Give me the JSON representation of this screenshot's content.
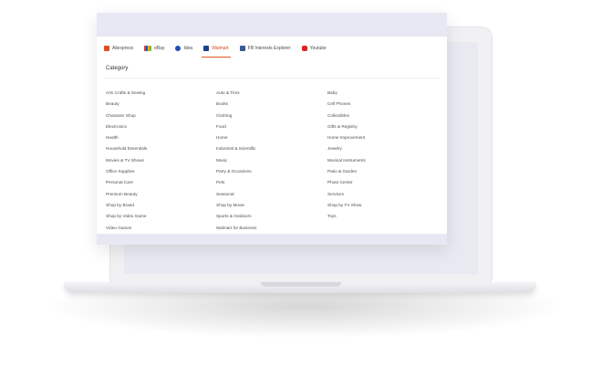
{
  "tabs": [
    {
      "label": "Aliexpress",
      "icon": "aliexpress-icon"
    },
    {
      "label": "eBay",
      "icon": "ebay-icon"
    },
    {
      "label": "Idea",
      "icon": "idea-icon"
    },
    {
      "label": "Walmart",
      "icon": "walmart-icon",
      "active": true
    },
    {
      "label": "FB Interests Explorer",
      "icon": "facebook-icon"
    },
    {
      "label": "Youtube",
      "icon": "youtube-icon"
    }
  ],
  "category_title": "Category",
  "categories": [
    [
      "Arts Crafts & Sewing",
      "Auto & Tires",
      "Baby"
    ],
    [
      "Beauty",
      "Books",
      "Cell Phones"
    ],
    [
      "Character Shop",
      "Clothing",
      "Collectibles"
    ],
    [
      "Electronics",
      "Food",
      "Gifts & Registry"
    ],
    [
      "Health",
      "Home",
      "Home Improvement"
    ],
    [
      "Household Essentials",
      "Industrial & Scientific",
      "Jewelry"
    ],
    [
      "Movies & TV Shows",
      "Music",
      "Musical Instruments"
    ],
    [
      "Office Supplies",
      "Party & Occasions",
      "Patio & Garden"
    ],
    [
      "Personal Care",
      "Pets",
      "Photo Center"
    ],
    [
      "Premium Beauty",
      "Seasonal",
      "Services"
    ],
    [
      "Shop by Brand",
      "Shop by Movie",
      "Shop by TV Show"
    ],
    [
      "Shop by Video Game",
      "Sports & Outdoors",
      "Toys"
    ],
    [
      "Video Games",
      "Walmart for Business",
      ""
    ]
  ],
  "colors": {
    "accent": "#e2581f",
    "panel_bg": "#e7e8f3"
  }
}
